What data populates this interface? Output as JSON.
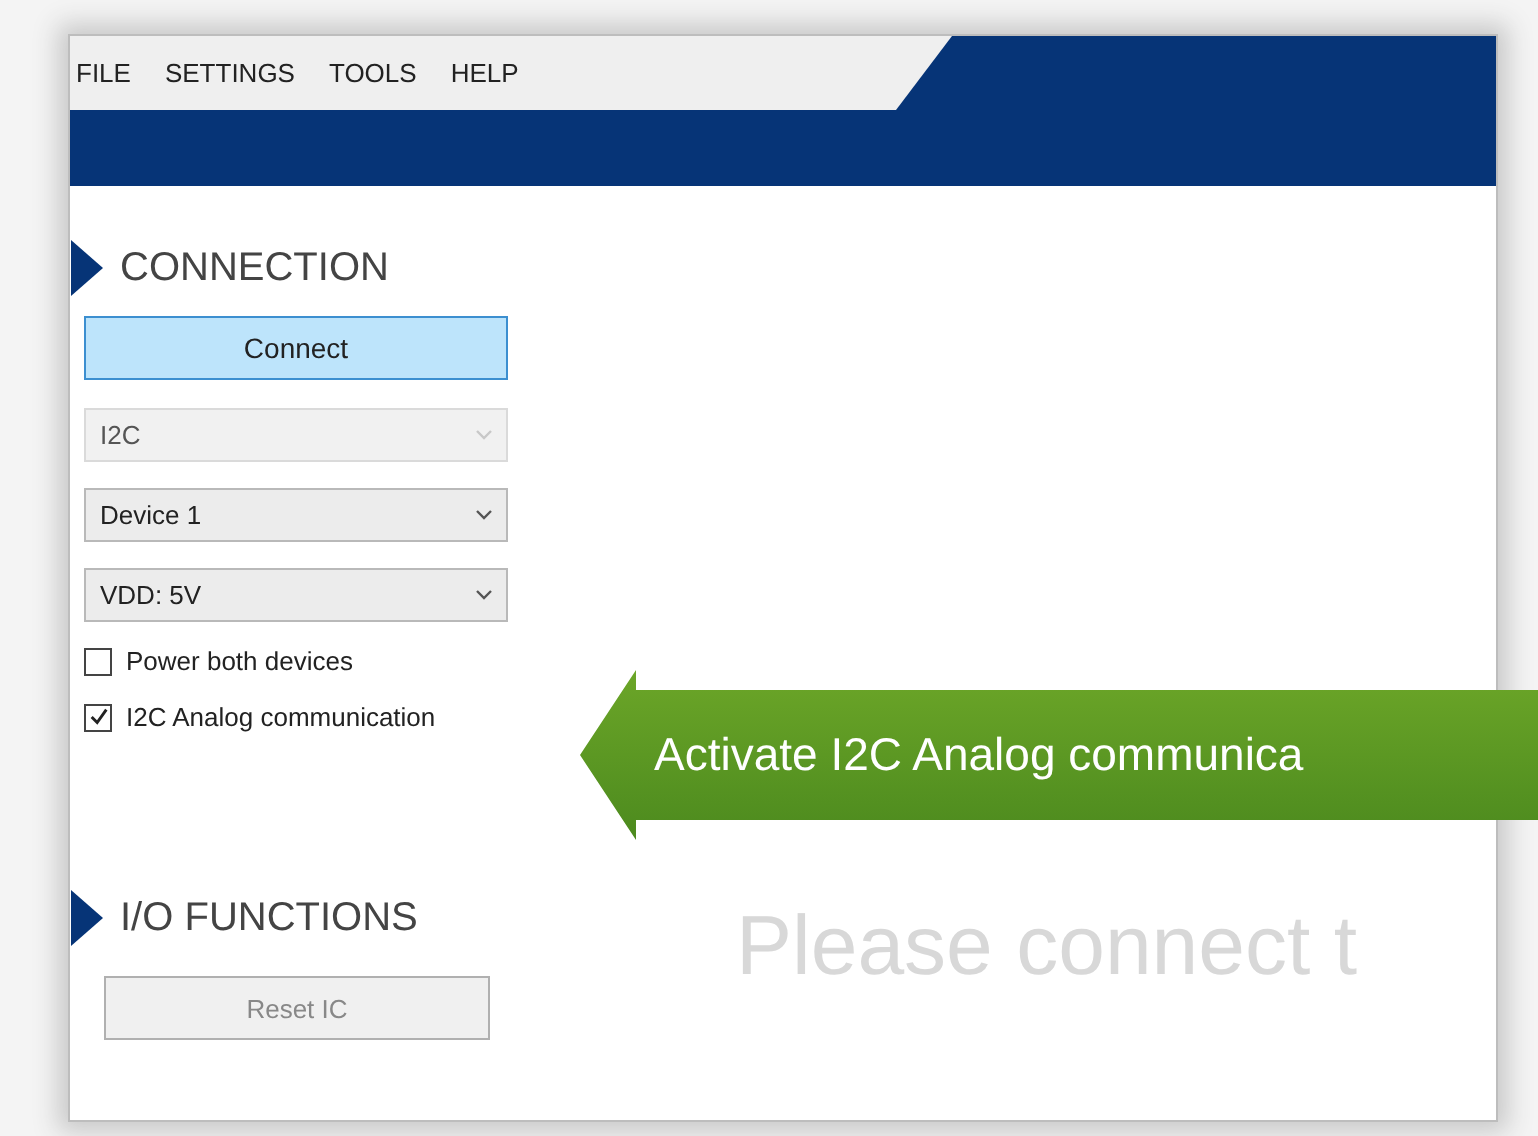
{
  "menu": [
    {
      "label": "FILE"
    },
    {
      "label": "SETTINGS"
    },
    {
      "label": "TOOLS"
    },
    {
      "label": "HELP"
    }
  ],
  "connection": {
    "title": "CONNECTION",
    "connect_button": "Connect",
    "dropdowns": [
      {
        "value": "I2C",
        "disabled": true
      },
      {
        "value": "Device 1",
        "disabled": false
      },
      {
        "value": "VDD: 5V",
        "disabled": false
      }
    ],
    "checkboxes": [
      {
        "label": "Power both devices",
        "checked": false
      },
      {
        "label": "I2C Analog communication",
        "checked": true
      }
    ]
  },
  "io_functions": {
    "title": "I/O FUNCTIONS",
    "reset_button": {
      "label": "Reset IC",
      "disabled": true
    }
  },
  "message": "Please connect t",
  "callout": "Activate I2C Analog communica"
}
